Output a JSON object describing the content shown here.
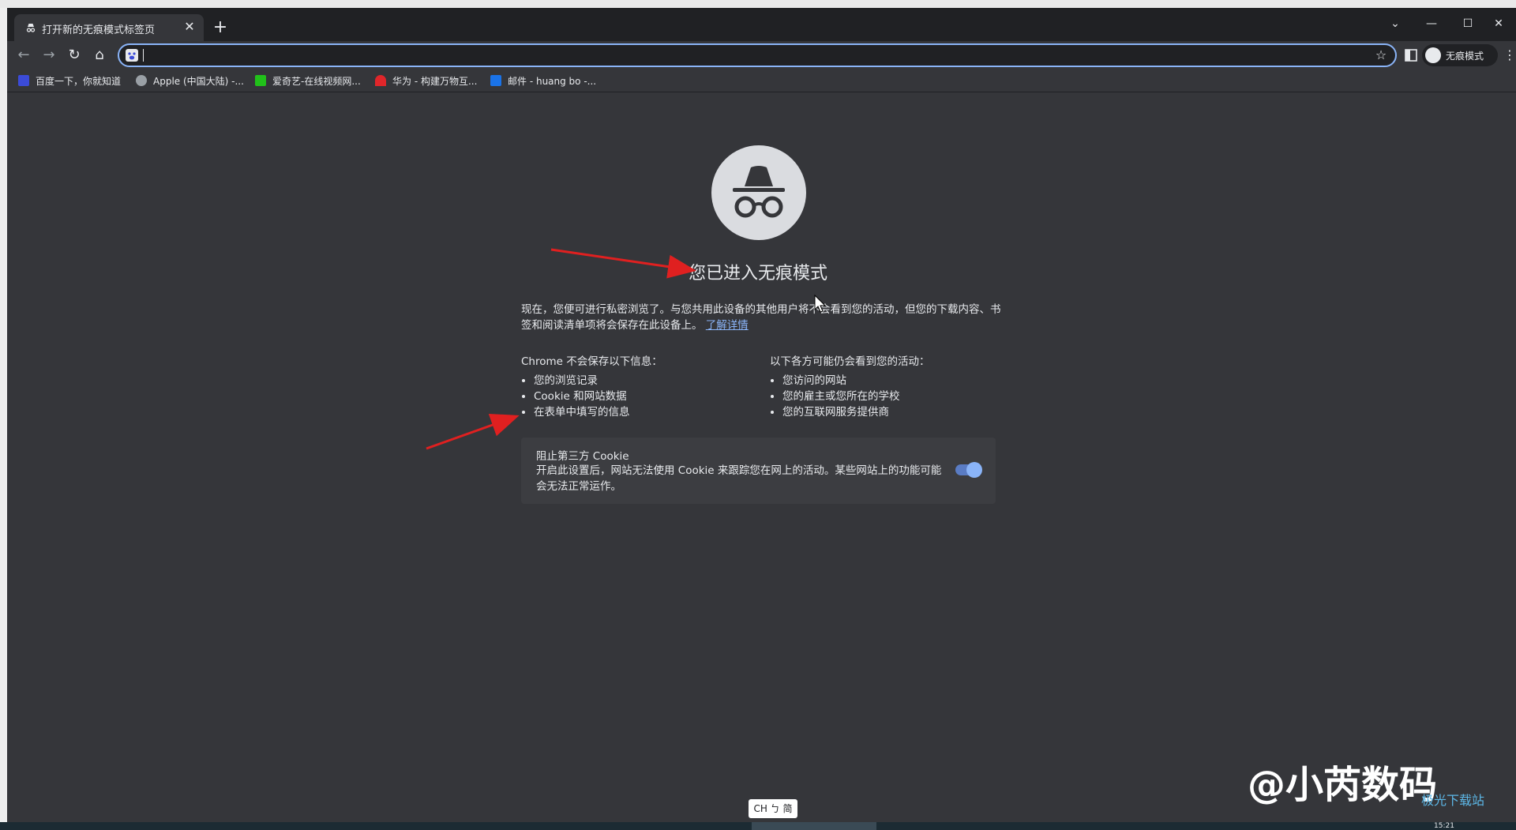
{
  "tab": {
    "title": "打开新的无痕模式标签页",
    "close": "✕",
    "new_tab": "+"
  },
  "window_controls": {
    "tab_search": "⌄",
    "minimize": "—",
    "maximize": "☐",
    "close": "✕"
  },
  "toolbar": {
    "back": "←",
    "forward": "→",
    "reload": "↻",
    "home": "⌂",
    "address_value": "",
    "bookmark_star": "☆",
    "profile_label": "无痕模式",
    "menu": "⋮"
  },
  "bookmarks": [
    {
      "label": "百度一下，你就知道",
      "color": "#3b4bd8"
    },
    {
      "label": "Apple (中国大陆) -...",
      "color": "#9aa0a6"
    },
    {
      "label": "爱奇艺-在线视频网...",
      "color": "#21c11a"
    },
    {
      "label": "华为 - 构建万物互...",
      "color": "#e0262a"
    },
    {
      "label": "邮件 - huang bo -...",
      "color": "#1a73e8"
    }
  ],
  "content": {
    "heading": "您已进入无痕模式",
    "intro": "现在，您便可进行私密浏览了。与您共用此设备的其他用户将不会看到您的活动，但您的下载内容、书签和阅读清单项将会保存在此设备上。",
    "learn_more": "了解详情",
    "not_saved_title": "Chrome 不会保存以下信息：",
    "not_saved": [
      "您的浏览记录",
      "Cookie 和网站数据",
      "在表单中填写的信息"
    ],
    "visible_to_title": "以下各方可能仍会看到您的活动：",
    "visible_to": [
      "您访问的网站",
      "您的雇主或您所在的学校",
      "您的互联网服务提供商"
    ],
    "cookie_title": "阻止第三方 Cookie",
    "cookie_desc": "开启此设置后，网站无法使用 Cookie 来跟踪您在网上的活动。某些网站上的功能可能会无法正常运作。",
    "cookie_toggle_on": true
  },
  "overlay": {
    "watermark": "@小芮数码",
    "watermark_site": "极光下载站",
    "ime": "CH ㄅ 简",
    "clock": "15:21"
  },
  "colors": {
    "accent": "#8ab4f8",
    "background": "#35363a",
    "arrow": "#e02020"
  }
}
